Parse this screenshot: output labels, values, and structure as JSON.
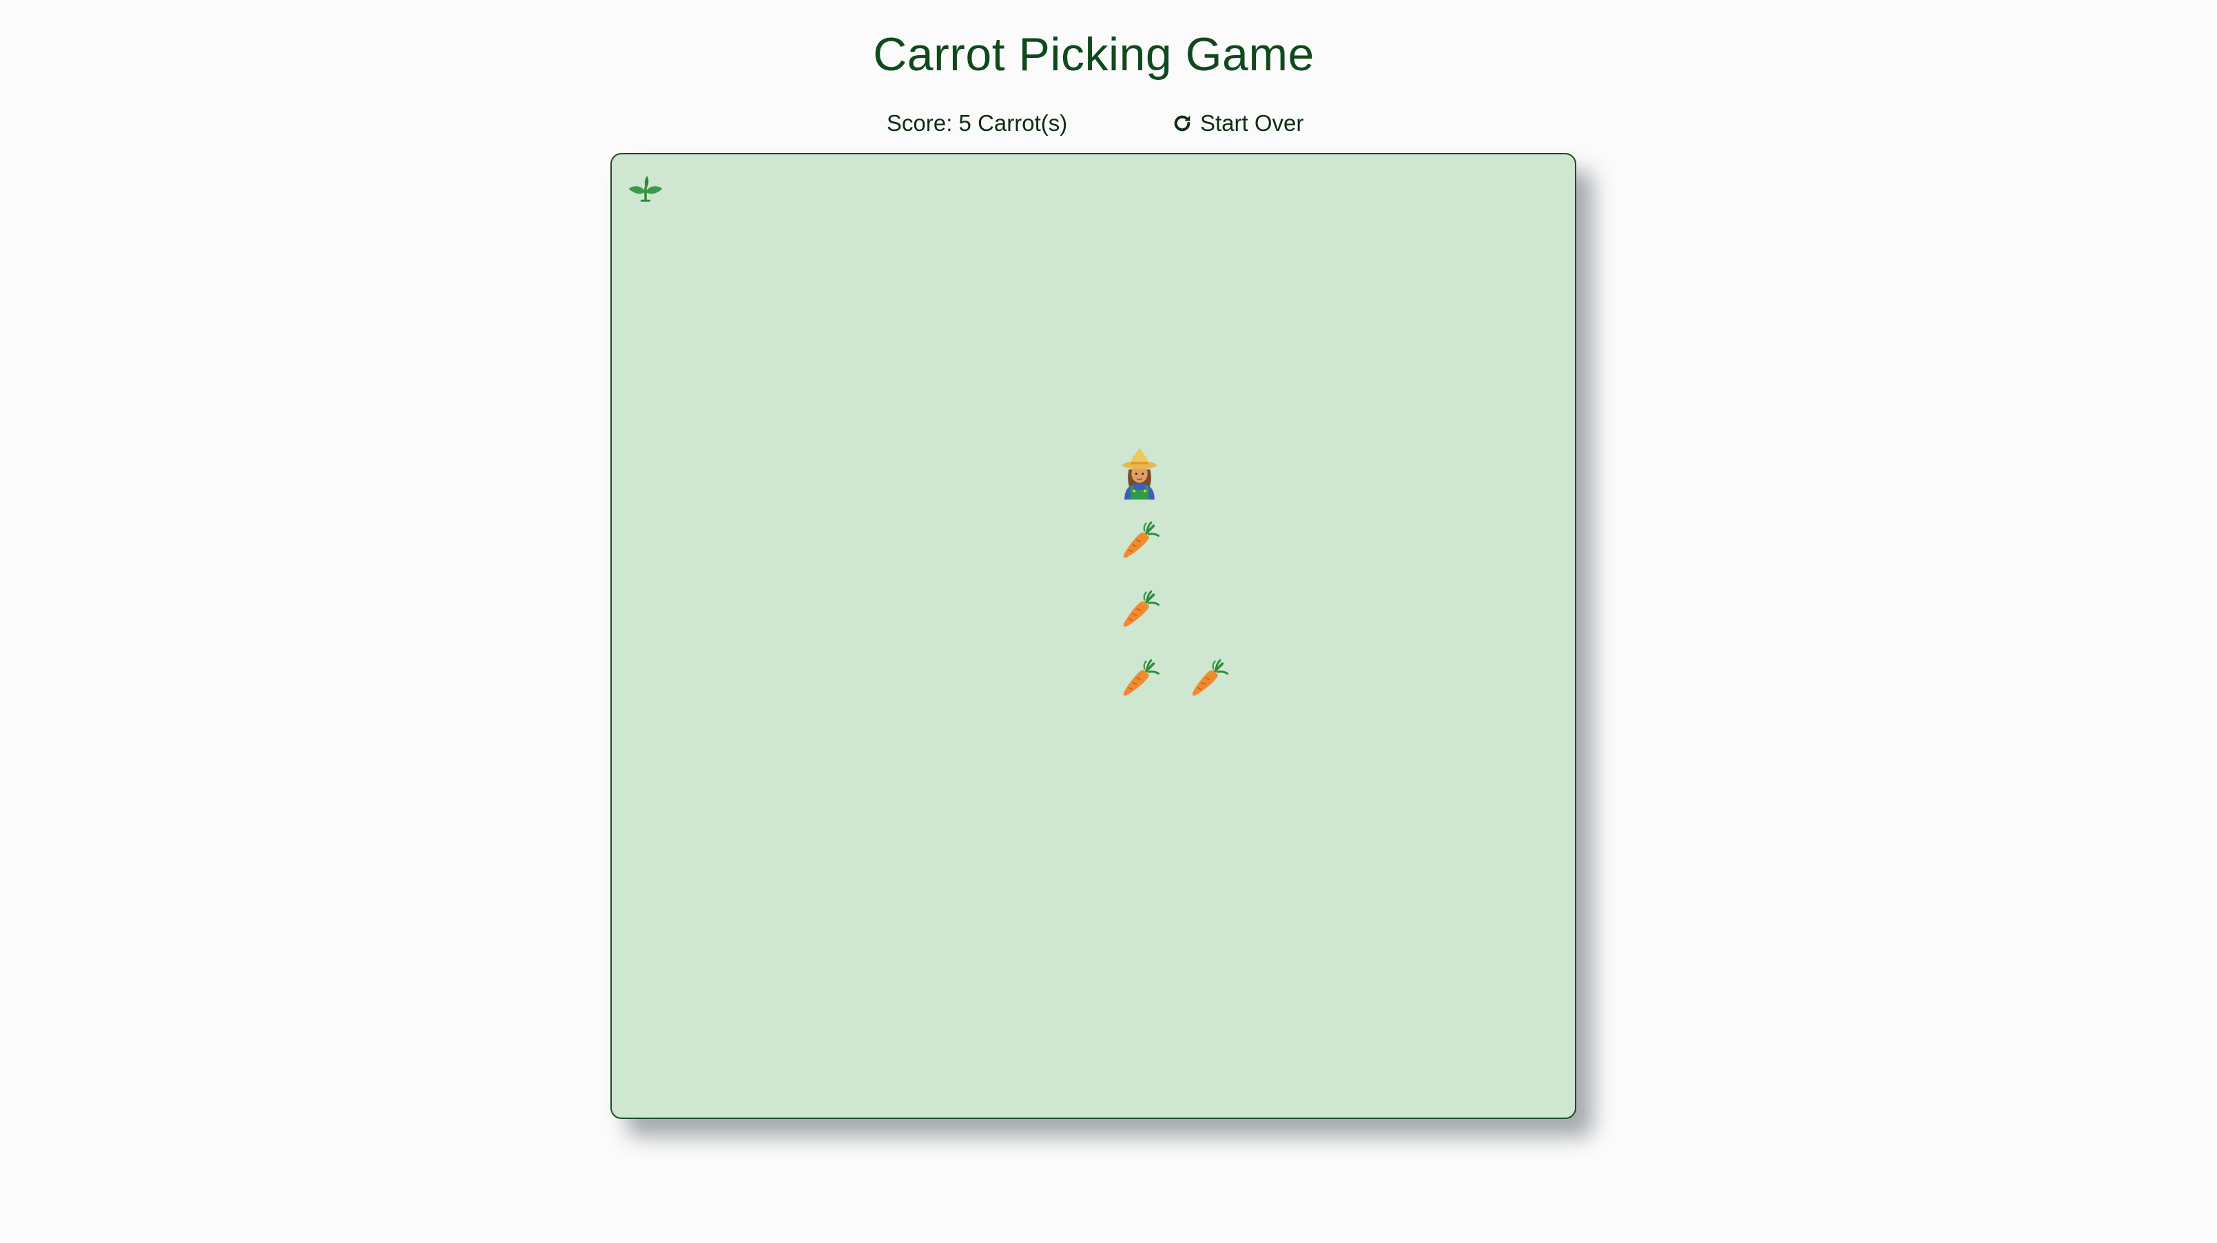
{
  "game": {
    "title": "Carrot Picking Game",
    "score_text": "Score: 5 Carrot(s)",
    "start_over_label": "Start Over"
  },
  "board": {
    "background_color": "#cfe6d0",
    "border_color": "#1f4a26",
    "grid_size": 14,
    "sprites": [
      {
        "kind": "sprout-icon",
        "row": 0,
        "col": 0
      },
      {
        "kind": "farmer-icon",
        "row": 4,
        "col": 7
      },
      {
        "kind": "carrot-icon",
        "row": 5,
        "col": 7
      },
      {
        "kind": "carrot-icon",
        "row": 6,
        "col": 7
      },
      {
        "kind": "carrot-icon",
        "row": 7,
        "col": 7
      },
      {
        "kind": "carrot-icon",
        "row": 7,
        "col": 8
      }
    ]
  }
}
